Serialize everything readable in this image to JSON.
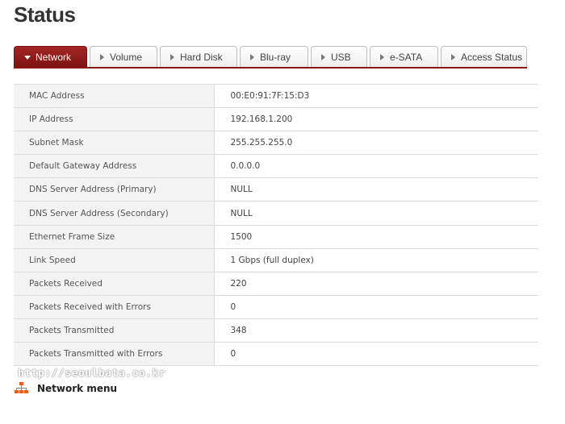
{
  "page": {
    "title": "Status"
  },
  "tabs": [
    {
      "label": "Network",
      "active": true
    },
    {
      "label": "Volume",
      "active": false
    },
    {
      "label": "Hard Disk",
      "active": false
    },
    {
      "label": "Blu-ray",
      "active": false
    },
    {
      "label": "USB",
      "active": false
    },
    {
      "label": "e-SATA",
      "active": false
    },
    {
      "label": "Access Status",
      "active": false
    }
  ],
  "network_info": [
    {
      "label": "MAC Address",
      "value": "00:E0:91:7F:15:D3"
    },
    {
      "label": "IP Address",
      "value": "192.168.1.200"
    },
    {
      "label": "Subnet Mask",
      "value": "255.255.255.0"
    },
    {
      "label": "Default Gateway Address",
      "value": "0.0.0.0"
    },
    {
      "label": "DNS Server Address (Primary)",
      "value": "NULL"
    },
    {
      "label": "DNS Server Address (Secondary)",
      "value": "NULL"
    },
    {
      "label": "Ethernet Frame Size",
      "value": "1500"
    },
    {
      "label": "Link Speed",
      "value": "1 Gbps (full duplex)"
    },
    {
      "label": "Packets Received",
      "value": "220"
    },
    {
      "label": "Packets Received with Errors",
      "value": "0"
    },
    {
      "label": "Packets Transmitted",
      "value": "348"
    },
    {
      "label": "Packets Transmitted with Errors",
      "value": "0"
    }
  ],
  "watermark": "http://seoulbata.co.kr",
  "footer": {
    "menu_label": "Network menu",
    "icon": "network-icon"
  },
  "colors": {
    "accent": "#8a1616",
    "tab_active": "#9a1e1e",
    "label_bg": "#f3f3f3",
    "border": "#dcdcdc"
  }
}
